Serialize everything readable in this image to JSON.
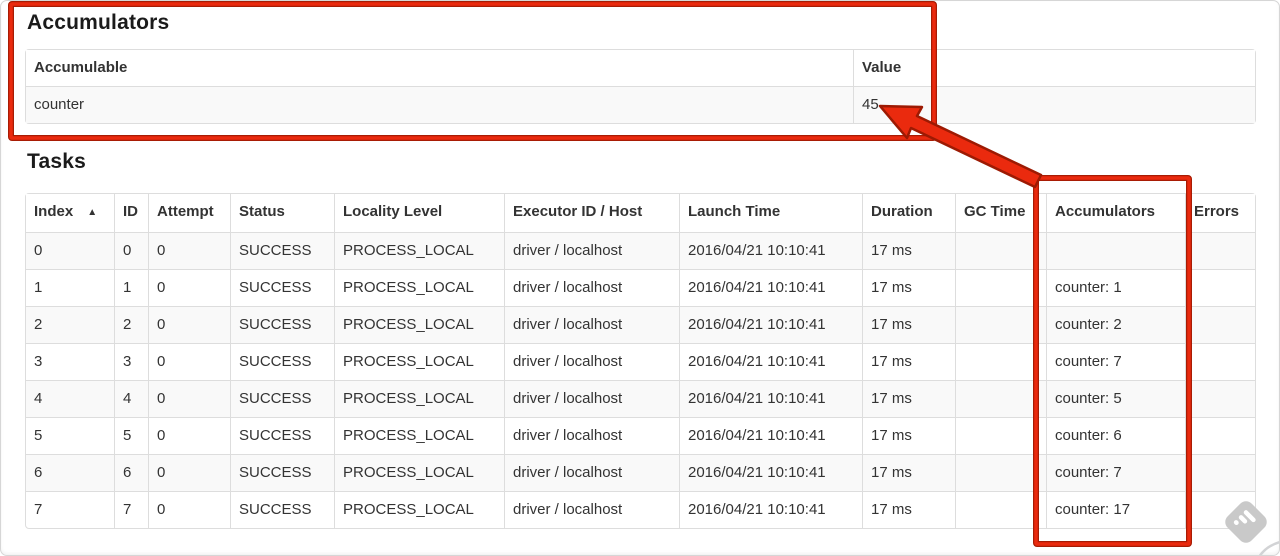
{
  "accumulators_section": {
    "title": "Accumulators",
    "table": {
      "col_accumulable": "Accumulable",
      "col_value": "Value",
      "rows": [
        {
          "accumulable": "counter",
          "value": "45"
        }
      ]
    }
  },
  "tasks_section": {
    "title": "Tasks",
    "table": {
      "headers": {
        "index": "Index",
        "sort_indicator": "▲",
        "id": "ID",
        "attempt": "Attempt",
        "status": "Status",
        "locality_level": "Locality Level",
        "executor_id_host": "Executor ID / Host",
        "launch_time": "Launch Time",
        "duration": "Duration",
        "gc_time": "GC Time",
        "accumulators": "Accumulators",
        "errors": "Errors"
      },
      "rows": [
        {
          "index": "0",
          "id": "0",
          "attempt": "0",
          "status": "SUCCESS",
          "locality_level": "PROCESS_LOCAL",
          "executor_id_host": "driver / localhost",
          "launch_time": "2016/04/21 10:10:41",
          "duration": "17 ms",
          "gc_time": "",
          "accumulators": "",
          "errors": ""
        },
        {
          "index": "1",
          "id": "1",
          "attempt": "0",
          "status": "SUCCESS",
          "locality_level": "PROCESS_LOCAL",
          "executor_id_host": "driver / localhost",
          "launch_time": "2016/04/21 10:10:41",
          "duration": "17 ms",
          "gc_time": "",
          "accumulators": "counter: 1",
          "errors": ""
        },
        {
          "index": "2",
          "id": "2",
          "attempt": "0",
          "status": "SUCCESS",
          "locality_level": "PROCESS_LOCAL",
          "executor_id_host": "driver / localhost",
          "launch_time": "2016/04/21 10:10:41",
          "duration": "17 ms",
          "gc_time": "",
          "accumulators": "counter: 2",
          "errors": ""
        },
        {
          "index": "3",
          "id": "3",
          "attempt": "0",
          "status": "SUCCESS",
          "locality_level": "PROCESS_LOCAL",
          "executor_id_host": "driver / localhost",
          "launch_time": "2016/04/21 10:10:41",
          "duration": "17 ms",
          "gc_time": "",
          "accumulators": "counter: 7",
          "errors": ""
        },
        {
          "index": "4",
          "id": "4",
          "attempt": "0",
          "status": "SUCCESS",
          "locality_level": "PROCESS_LOCAL",
          "executor_id_host": "driver / localhost",
          "launch_time": "2016/04/21 10:10:41",
          "duration": "17 ms",
          "gc_time": "",
          "accumulators": "counter: 5",
          "errors": ""
        },
        {
          "index": "5",
          "id": "5",
          "attempt": "0",
          "status": "SUCCESS",
          "locality_level": "PROCESS_LOCAL",
          "executor_id_host": "driver / localhost",
          "launch_time": "2016/04/21 10:10:41",
          "duration": "17 ms",
          "gc_time": "",
          "accumulators": "counter: 6",
          "errors": ""
        },
        {
          "index": "6",
          "id": "6",
          "attempt": "0",
          "status": "SUCCESS",
          "locality_level": "PROCESS_LOCAL",
          "executor_id_host": "driver / localhost",
          "launch_time": "2016/04/21 10:10:41",
          "duration": "17 ms",
          "gc_time": "",
          "accumulators": "counter: 7",
          "errors": ""
        },
        {
          "index": "7",
          "id": "7",
          "attempt": "0",
          "status": "SUCCESS",
          "locality_level": "PROCESS_LOCAL",
          "executor_id_host": "driver / localhost",
          "launch_time": "2016/04/21 10:10:41",
          "duration": "17 ms",
          "gc_time": "",
          "accumulators": "counter: 17",
          "errors": ""
        }
      ]
    }
  },
  "annotations": {
    "highlight_color": "#ea2a0e",
    "outline_color": "#a81c04"
  },
  "watermark": {
    "icon_color": "#c9c9c9"
  }
}
